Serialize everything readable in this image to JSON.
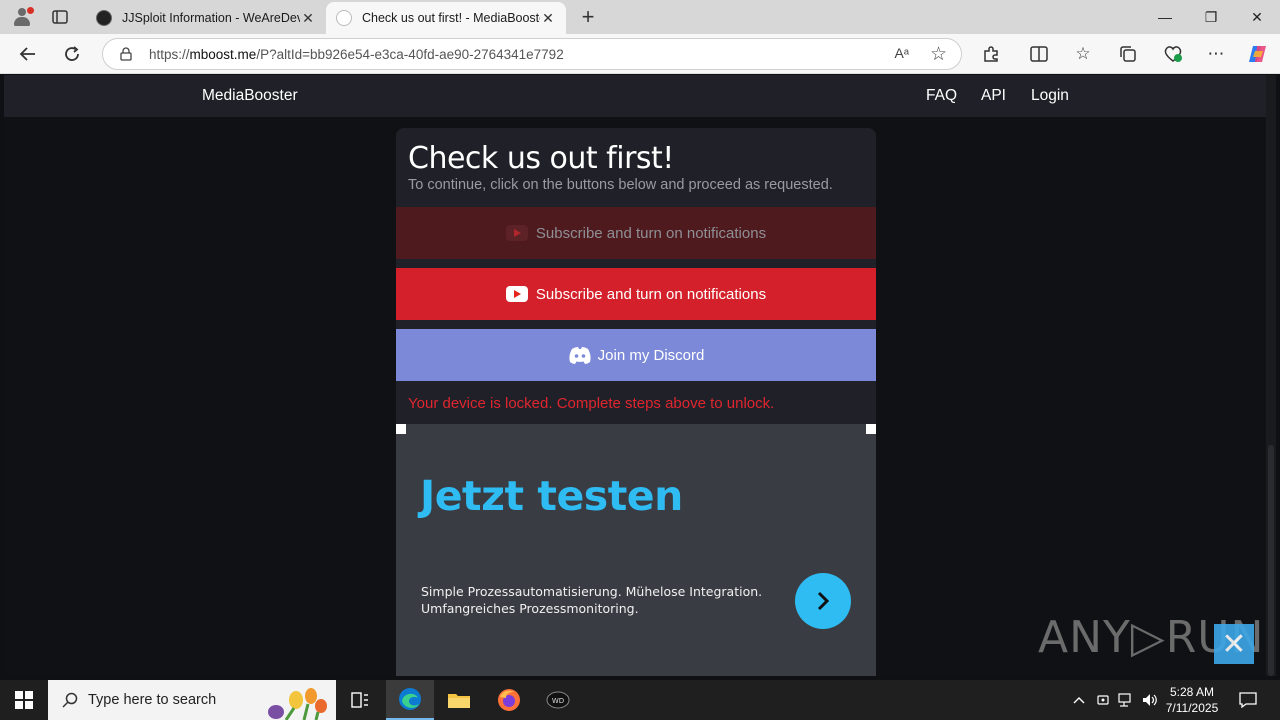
{
  "browser": {
    "tabs": [
      {
        "title": "JJSploit Information - WeAreDevs",
        "active": false
      },
      {
        "title": "Check us out first! - MediaBooster",
        "active": true
      }
    ],
    "new_tab": "+",
    "window_controls": {
      "minimize": "—",
      "maximize": "❐",
      "close": "✕"
    },
    "address": {
      "prefix": "https://",
      "domain": "mboost.me",
      "path": "/P?altId=bb926e54-e3ca-40fd-ae90-2764341e7792"
    },
    "read_aloud": "Aᵃ"
  },
  "site": {
    "brand": "MediaBooster",
    "nav": [
      "FAQ",
      "API",
      "Login"
    ]
  },
  "card": {
    "title": "Check us out first!",
    "subtitle": "To continue, click on the buttons below and proceed as requested.",
    "steps": [
      {
        "label": "Subscribe and turn on notifications",
        "state": "completed"
      },
      {
        "label": "Subscribe and turn on notifications",
        "state": "pending"
      },
      {
        "label": "Join my Discord",
        "state": "pending"
      }
    ],
    "lock_message": "Your device is locked. Complete steps above to unlock."
  },
  "ad": {
    "headline": "Jetzt testen",
    "desc_line1": "Simple Prozessautomatisierung. Mühelose Integration.",
    "desc_line2": "Umfangreiches Prozessmonitoring."
  },
  "watermark": "ANY▷RUN",
  "taskbar": {
    "search_placeholder": "Type here to search",
    "time": "5:28 AM",
    "date": "7/11/2025"
  },
  "colors": {
    "youtube_red": "#d4202a",
    "discord": "#7b89d8",
    "lock_text": "#e0252f",
    "ad_accent": "#2fbcf2"
  }
}
